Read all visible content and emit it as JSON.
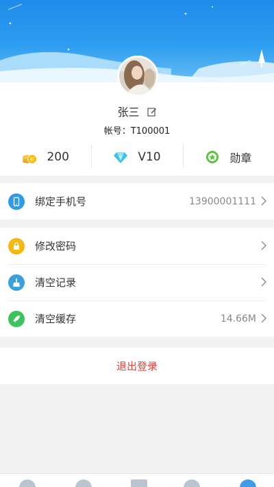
{
  "profile": {
    "name": "张三",
    "account_label": "帐号：",
    "account_id": "T100001"
  },
  "stats": [
    {
      "icon": "coin-icon",
      "value": "200"
    },
    {
      "icon": "diamond-icon",
      "value": "V10"
    },
    {
      "icon": "medal-icon",
      "value": "勋章"
    }
  ],
  "settings": {
    "phone": {
      "label": "绑定手机号",
      "value": "13900001111"
    },
    "password": {
      "label": "修改密码"
    },
    "clear_history": {
      "label": "清空记录"
    },
    "clear_cache": {
      "label": "清空缓存",
      "value": "14.66M"
    }
  },
  "logout_label": "退出登录",
  "colors": {
    "header_blue": "#1e8bea",
    "phone_icon": "#2e9be6",
    "password_icon": "#f5b80c",
    "history_icon": "#3aa0e0",
    "cache_icon": "#3cc35e",
    "logout_text": "#e0443e"
  }
}
